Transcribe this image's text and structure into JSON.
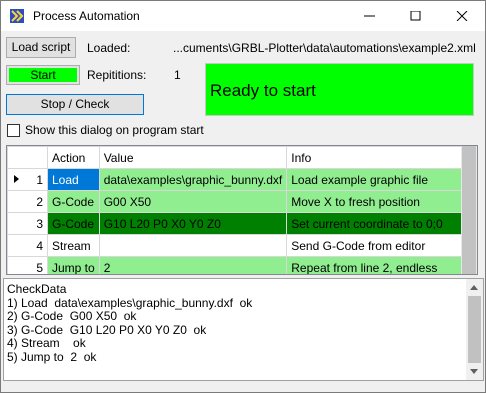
{
  "window": {
    "title": "Process Automation"
  },
  "toolbar": {
    "load_script": "Load script",
    "loaded_label": "Loaded:",
    "loaded_path": "...cuments\\GRBL-Plotter\\data\\automations\\example2.xml",
    "start": "Start",
    "repetitions_label": "Repititions:",
    "repetitions_value": "1",
    "stop_check": "Stop / Check",
    "status_text": "Ready to start",
    "show_dialog_label": "Show this dialog on program start"
  },
  "grid": {
    "columns": [
      "Action",
      "Value",
      "Info"
    ],
    "rows": [
      {
        "num": "1",
        "action": "Load",
        "value": "data\\examples\\graphic_bunny.dxf",
        "info": "Load example graphic file"
      },
      {
        "num": "2",
        "action": "G-Code",
        "value": "G00 X50",
        "info": "Move X to fresh position"
      },
      {
        "num": "3",
        "action": "G-Code",
        "value": "G10 L20 P0 X0 Y0 Z0",
        "info": "Set current coordinate to 0;0"
      },
      {
        "num": "4",
        "action": "Stream",
        "value": "",
        "info": "Send G-Code from editor"
      },
      {
        "num": "5",
        "action": "Jump to",
        "value": "2",
        "info": "Repeat from line 2, endless"
      }
    ]
  },
  "log": {
    "lines": [
      "CheckData",
      "1) Load  data\\examples\\graphic_bunny.dxf  ok",
      "2) G-Code  G00 X50  ok",
      "3) G-Code  G10 L20 P0 X0 Y0 Z0  ok",
      "4) Stream    ok",
      "5) Jump to  2  ok"
    ]
  },
  "colors": {
    "start_button": "#00ff00",
    "status_ready": "#00ff00",
    "row_ok": "#90ee90",
    "row_active": "#008000",
    "cell_selected": "#0078d7"
  }
}
